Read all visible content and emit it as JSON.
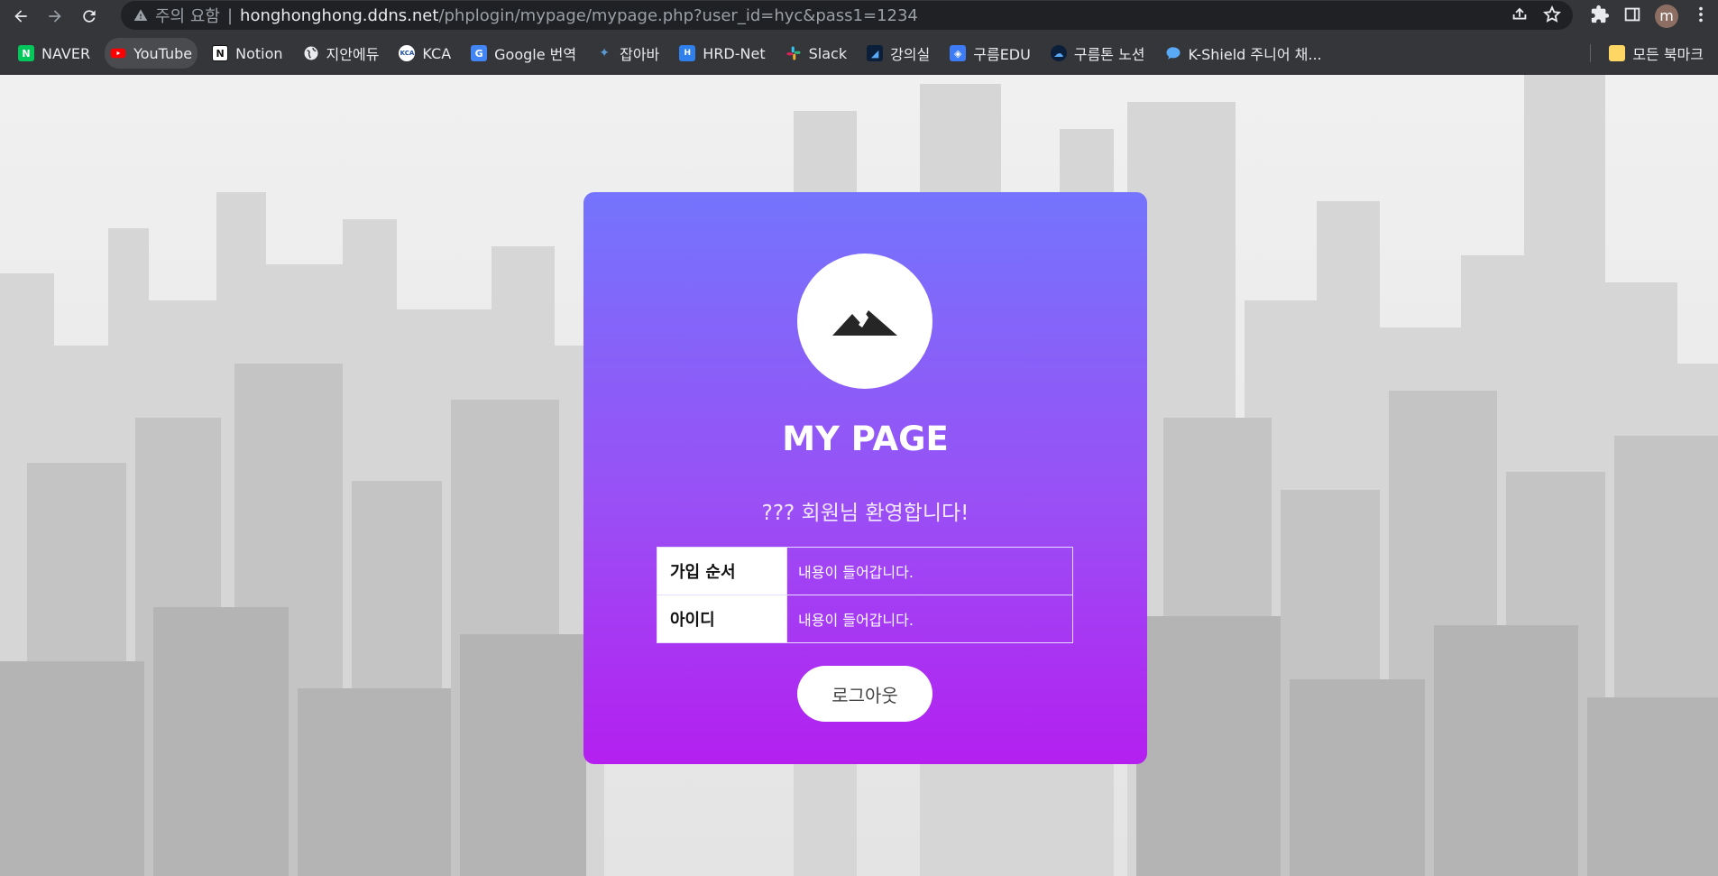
{
  "browser": {
    "security_warning": "주의 요함",
    "url_host": "honghonghong.ddns.net",
    "url_path": "/phplogin/mypage/mypage.php?user_id=hyc&pass1=1234",
    "avatar_letter": "m"
  },
  "bookmarks": {
    "items": [
      {
        "label": "NAVER",
        "icon": "naver-icon",
        "color": "#03c75a"
      },
      {
        "label": "YouTube",
        "icon": "youtube-icon",
        "color": "#ff0000"
      },
      {
        "label": "Notion",
        "icon": "notion-icon",
        "color": "#ffffff"
      },
      {
        "label": "지안에듀",
        "icon": "globe-icon",
        "color": "#e8eaed"
      },
      {
        "label": "KCA",
        "icon": "kca-icon",
        "color": "#e8eaed"
      },
      {
        "label": "Google 번역",
        "icon": "google-translate-icon",
        "color": "#4285f4"
      },
      {
        "label": "잡아바",
        "icon": "jobaba-icon",
        "color": "#5b9bd5"
      },
      {
        "label": "HRD-Net",
        "icon": "hrd-net-icon",
        "color": "#2f80ed"
      },
      {
        "label": "Slack",
        "icon": "slack-icon",
        "color": "#e01e5a"
      },
      {
        "label": "강의실",
        "icon": "classroom-icon",
        "color": "#0b1e3a"
      },
      {
        "label": "구름EDU",
        "icon": "goorm-edu-icon",
        "color": "#3d7bf7"
      },
      {
        "label": "구름톤 노션",
        "icon": "goormthon-icon",
        "color": "#0b1e3a"
      },
      {
        "label": "K-Shield 주니어 채...",
        "icon": "chat-bubble-icon",
        "color": "#5aa9f5"
      }
    ],
    "all_bookmarks_label": "모든 북마크"
  },
  "page": {
    "title": "MY PAGE",
    "welcome": "??? 회원님 환영합니다!",
    "rows": [
      {
        "key": "가입 순서",
        "value": "내용이 들어갑니다."
      },
      {
        "key": "아이디",
        "value": "내용이 들어갑니다."
      }
    ],
    "logout_label": "로그아웃",
    "colors": {
      "gradient_top": "#7474fd",
      "gradient_bottom": "#b41ff0"
    }
  }
}
